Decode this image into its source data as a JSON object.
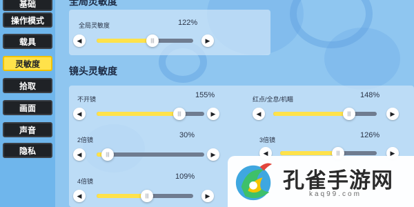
{
  "sidebar": {
    "items": [
      {
        "label": "基础",
        "active": false
      },
      {
        "label": "操作模式",
        "active": false
      },
      {
        "label": "载具",
        "active": false
      },
      {
        "label": "灵敏度",
        "active": true
      },
      {
        "label": "拾取",
        "active": false
      },
      {
        "label": "画面",
        "active": false
      },
      {
        "label": "声音",
        "active": false
      },
      {
        "label": "隐私",
        "active": false
      }
    ]
  },
  "sections": {
    "top": {
      "title": "全局灵敏度"
    },
    "lens": {
      "title": "镜头灵敏度"
    }
  },
  "sliders": {
    "global": {
      "label": "全局灵敏度",
      "value": "122%",
      "fraction": 0.58
    },
    "no_scope": {
      "label": "不开镜",
      "value": "155%",
      "fraction": 0.77
    },
    "red_dot": {
      "label": "红点/全息/机瞄",
      "value": "148%",
      "fraction": 0.73
    },
    "x2": {
      "label": "2倍镜",
      "value": "30%",
      "fraction": 0.1
    },
    "x3": {
      "label": "3倍镜",
      "value": "126%",
      "fraction": 0.6
    },
    "x4": {
      "label": "4倍镜",
      "value": "109%",
      "fraction": 0.52
    }
  },
  "icons": {
    "decrease": "◀",
    "increase": "▶",
    "thumb": "|||"
  },
  "watermark": {
    "text": "孔雀手游网",
    "sub": "kaq99.com"
  },
  "colors": {
    "accent": "#ffe24a",
    "dark": "#1f2226",
    "track": "#6f7c90",
    "background": "#8fc6f0"
  }
}
